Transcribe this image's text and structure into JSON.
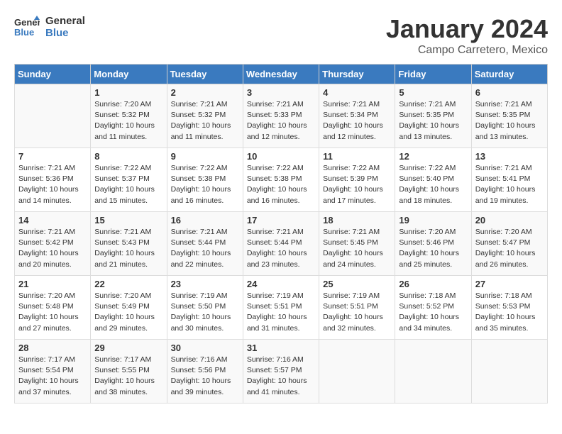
{
  "header": {
    "logo_line1": "General",
    "logo_line2": "Blue",
    "month": "January 2024",
    "location": "Campo Carretero, Mexico"
  },
  "weekdays": [
    "Sunday",
    "Monday",
    "Tuesday",
    "Wednesday",
    "Thursday",
    "Friday",
    "Saturday"
  ],
  "weeks": [
    [
      {
        "day": "",
        "info": ""
      },
      {
        "day": "1",
        "info": "Sunrise: 7:20 AM\nSunset: 5:32 PM\nDaylight: 10 hours\nand 11 minutes."
      },
      {
        "day": "2",
        "info": "Sunrise: 7:21 AM\nSunset: 5:32 PM\nDaylight: 10 hours\nand 11 minutes."
      },
      {
        "day": "3",
        "info": "Sunrise: 7:21 AM\nSunset: 5:33 PM\nDaylight: 10 hours\nand 12 minutes."
      },
      {
        "day": "4",
        "info": "Sunrise: 7:21 AM\nSunset: 5:34 PM\nDaylight: 10 hours\nand 12 minutes."
      },
      {
        "day": "5",
        "info": "Sunrise: 7:21 AM\nSunset: 5:35 PM\nDaylight: 10 hours\nand 13 minutes."
      },
      {
        "day": "6",
        "info": "Sunrise: 7:21 AM\nSunset: 5:35 PM\nDaylight: 10 hours\nand 13 minutes."
      }
    ],
    [
      {
        "day": "7",
        "info": "Sunrise: 7:21 AM\nSunset: 5:36 PM\nDaylight: 10 hours\nand 14 minutes."
      },
      {
        "day": "8",
        "info": "Sunrise: 7:22 AM\nSunset: 5:37 PM\nDaylight: 10 hours\nand 15 minutes."
      },
      {
        "day": "9",
        "info": "Sunrise: 7:22 AM\nSunset: 5:38 PM\nDaylight: 10 hours\nand 16 minutes."
      },
      {
        "day": "10",
        "info": "Sunrise: 7:22 AM\nSunset: 5:38 PM\nDaylight: 10 hours\nand 16 minutes."
      },
      {
        "day": "11",
        "info": "Sunrise: 7:22 AM\nSunset: 5:39 PM\nDaylight: 10 hours\nand 17 minutes."
      },
      {
        "day": "12",
        "info": "Sunrise: 7:22 AM\nSunset: 5:40 PM\nDaylight: 10 hours\nand 18 minutes."
      },
      {
        "day": "13",
        "info": "Sunrise: 7:21 AM\nSunset: 5:41 PM\nDaylight: 10 hours\nand 19 minutes."
      }
    ],
    [
      {
        "day": "14",
        "info": "Sunrise: 7:21 AM\nSunset: 5:42 PM\nDaylight: 10 hours\nand 20 minutes."
      },
      {
        "day": "15",
        "info": "Sunrise: 7:21 AM\nSunset: 5:43 PM\nDaylight: 10 hours\nand 21 minutes."
      },
      {
        "day": "16",
        "info": "Sunrise: 7:21 AM\nSunset: 5:44 PM\nDaylight: 10 hours\nand 22 minutes."
      },
      {
        "day": "17",
        "info": "Sunrise: 7:21 AM\nSunset: 5:44 PM\nDaylight: 10 hours\nand 23 minutes."
      },
      {
        "day": "18",
        "info": "Sunrise: 7:21 AM\nSunset: 5:45 PM\nDaylight: 10 hours\nand 24 minutes."
      },
      {
        "day": "19",
        "info": "Sunrise: 7:20 AM\nSunset: 5:46 PM\nDaylight: 10 hours\nand 25 minutes."
      },
      {
        "day": "20",
        "info": "Sunrise: 7:20 AM\nSunset: 5:47 PM\nDaylight: 10 hours\nand 26 minutes."
      }
    ],
    [
      {
        "day": "21",
        "info": "Sunrise: 7:20 AM\nSunset: 5:48 PM\nDaylight: 10 hours\nand 27 minutes."
      },
      {
        "day": "22",
        "info": "Sunrise: 7:20 AM\nSunset: 5:49 PM\nDaylight: 10 hours\nand 29 minutes."
      },
      {
        "day": "23",
        "info": "Sunrise: 7:19 AM\nSunset: 5:50 PM\nDaylight: 10 hours\nand 30 minutes."
      },
      {
        "day": "24",
        "info": "Sunrise: 7:19 AM\nSunset: 5:51 PM\nDaylight: 10 hours\nand 31 minutes."
      },
      {
        "day": "25",
        "info": "Sunrise: 7:19 AM\nSunset: 5:51 PM\nDaylight: 10 hours\nand 32 minutes."
      },
      {
        "day": "26",
        "info": "Sunrise: 7:18 AM\nSunset: 5:52 PM\nDaylight: 10 hours\nand 34 minutes."
      },
      {
        "day": "27",
        "info": "Sunrise: 7:18 AM\nSunset: 5:53 PM\nDaylight: 10 hours\nand 35 minutes."
      }
    ],
    [
      {
        "day": "28",
        "info": "Sunrise: 7:17 AM\nSunset: 5:54 PM\nDaylight: 10 hours\nand 37 minutes."
      },
      {
        "day": "29",
        "info": "Sunrise: 7:17 AM\nSunset: 5:55 PM\nDaylight: 10 hours\nand 38 minutes."
      },
      {
        "day": "30",
        "info": "Sunrise: 7:16 AM\nSunset: 5:56 PM\nDaylight: 10 hours\nand 39 minutes."
      },
      {
        "day": "31",
        "info": "Sunrise: 7:16 AM\nSunset: 5:57 PM\nDaylight: 10 hours\nand 41 minutes."
      },
      {
        "day": "",
        "info": ""
      },
      {
        "day": "",
        "info": ""
      },
      {
        "day": "",
        "info": ""
      }
    ]
  ]
}
